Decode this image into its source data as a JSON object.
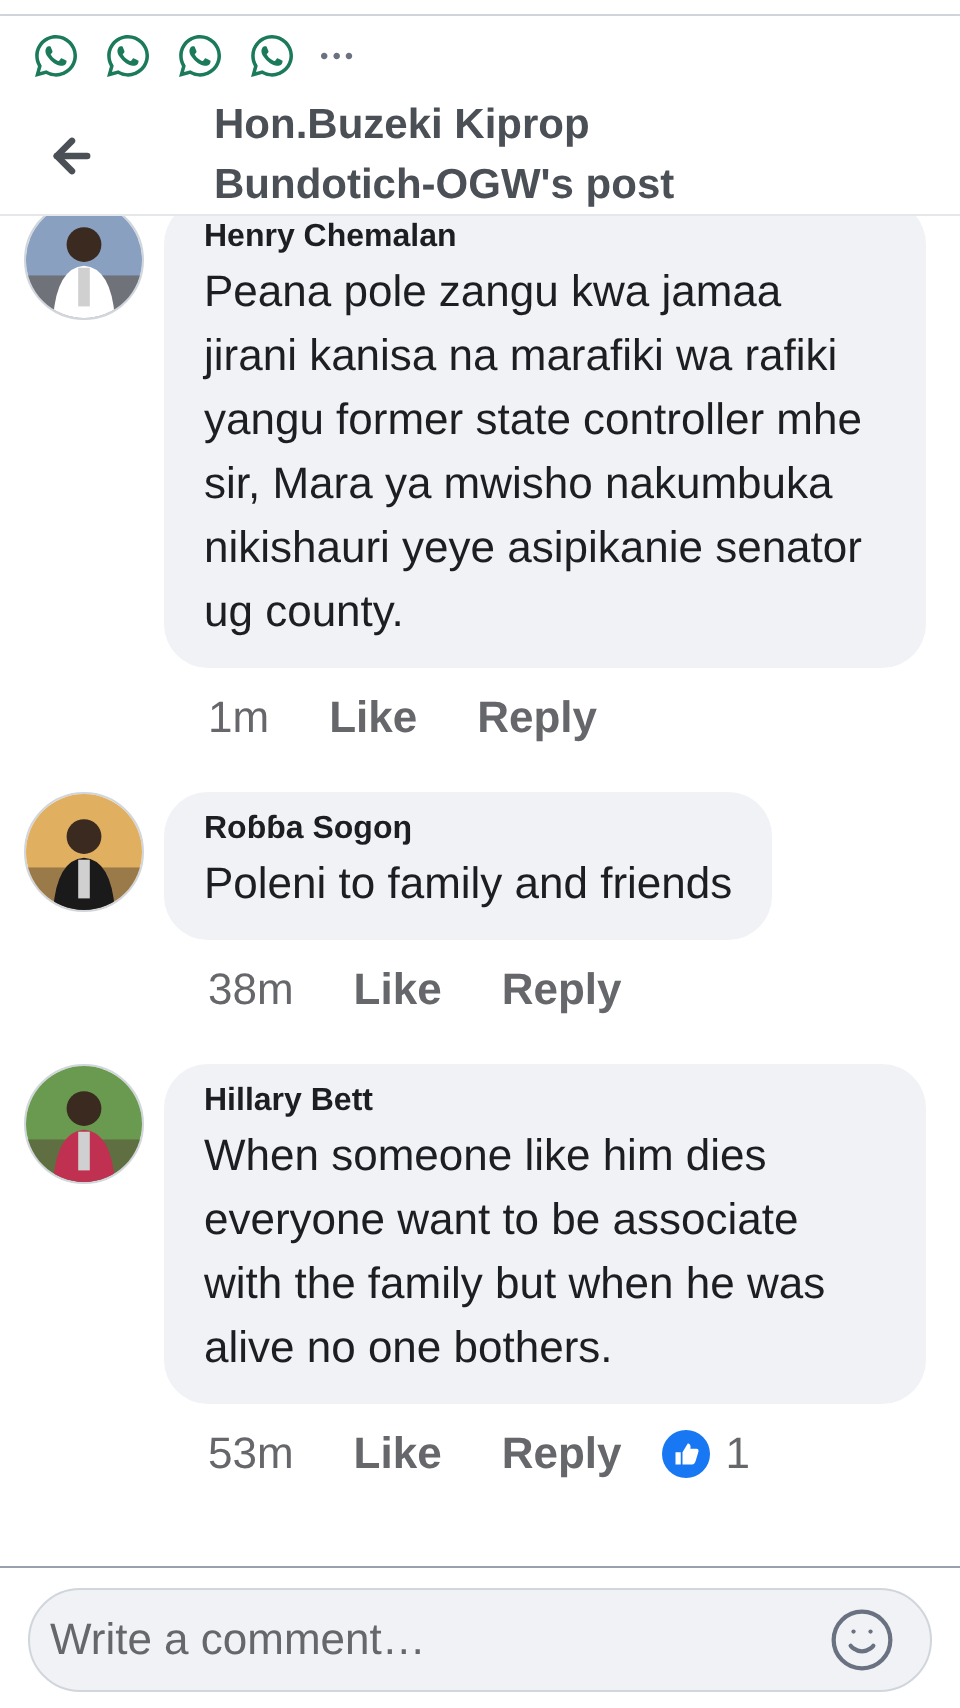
{
  "status_bar": {
    "notifications": [
      {
        "kind": "whatsapp"
      },
      {
        "kind": "whatsapp"
      },
      {
        "kind": "whatsapp"
      },
      {
        "kind": "whatsapp"
      }
    ],
    "more": "•••"
  },
  "header": {
    "title": "Hon.Buzeki Kiprop Bundotich-OGW's post"
  },
  "comments": [
    {
      "author": "Henry Chemalan",
      "text": "Peana pole zangu kwa jamaa jirani kanisa na marafiki wa rafiki yangu former state controller mhe sir, Mara ya mwisho nakumbuka nikishauri yeye asipikanie senator ug county.",
      "time": "1m",
      "like": "Like",
      "reply": "Reply"
    },
    {
      "author": "Roɓɓa Sogoŋ",
      "text": "Poleni to family and friends",
      "time": "38m",
      "like": "Like",
      "reply": "Reply"
    },
    {
      "author": "Hillary Bett",
      "text": "When someone like him  dies everyone want to be associate with the family but when he was alive no one bothers.",
      "time": "53m",
      "like": "Like",
      "reply": "Reply",
      "reactions": "1"
    }
  ],
  "composer": {
    "placeholder": "Write a comment…"
  }
}
